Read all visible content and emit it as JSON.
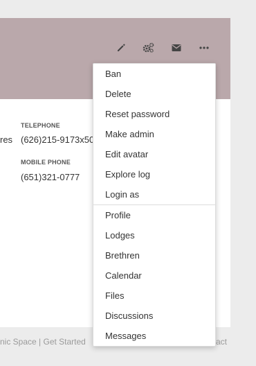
{
  "colors": {
    "header_bg": "#baa8ab",
    "page_bg": "#ececec",
    "icon_color": "#444444"
  },
  "header": {
    "icons": [
      "pencil-icon",
      "gears-icon",
      "envelope-icon",
      "more-icon"
    ]
  },
  "profile": {
    "left_fragment": "res",
    "telephone_label": "TELEPHONE",
    "telephone_value": "(626)215-9173x50",
    "mobile_label": "MOBILE PHONE",
    "mobile_value": "(651)321-0777"
  },
  "footer": {
    "left_text": "nic Space  |  Get Started",
    "right_text": "act"
  },
  "menu": {
    "admin_items": [
      {
        "label": "Ban"
      },
      {
        "label": "Delete"
      },
      {
        "label": "Reset password"
      },
      {
        "label": "Make admin"
      },
      {
        "label": "Edit avatar"
      },
      {
        "label": "Explore log"
      },
      {
        "label": "Login as"
      }
    ],
    "nav_items": [
      {
        "label": "Profile"
      },
      {
        "label": "Lodges"
      },
      {
        "label": "Brethren"
      },
      {
        "label": "Calendar"
      },
      {
        "label": "Files"
      },
      {
        "label": "Discussions"
      },
      {
        "label": "Messages"
      }
    ]
  }
}
